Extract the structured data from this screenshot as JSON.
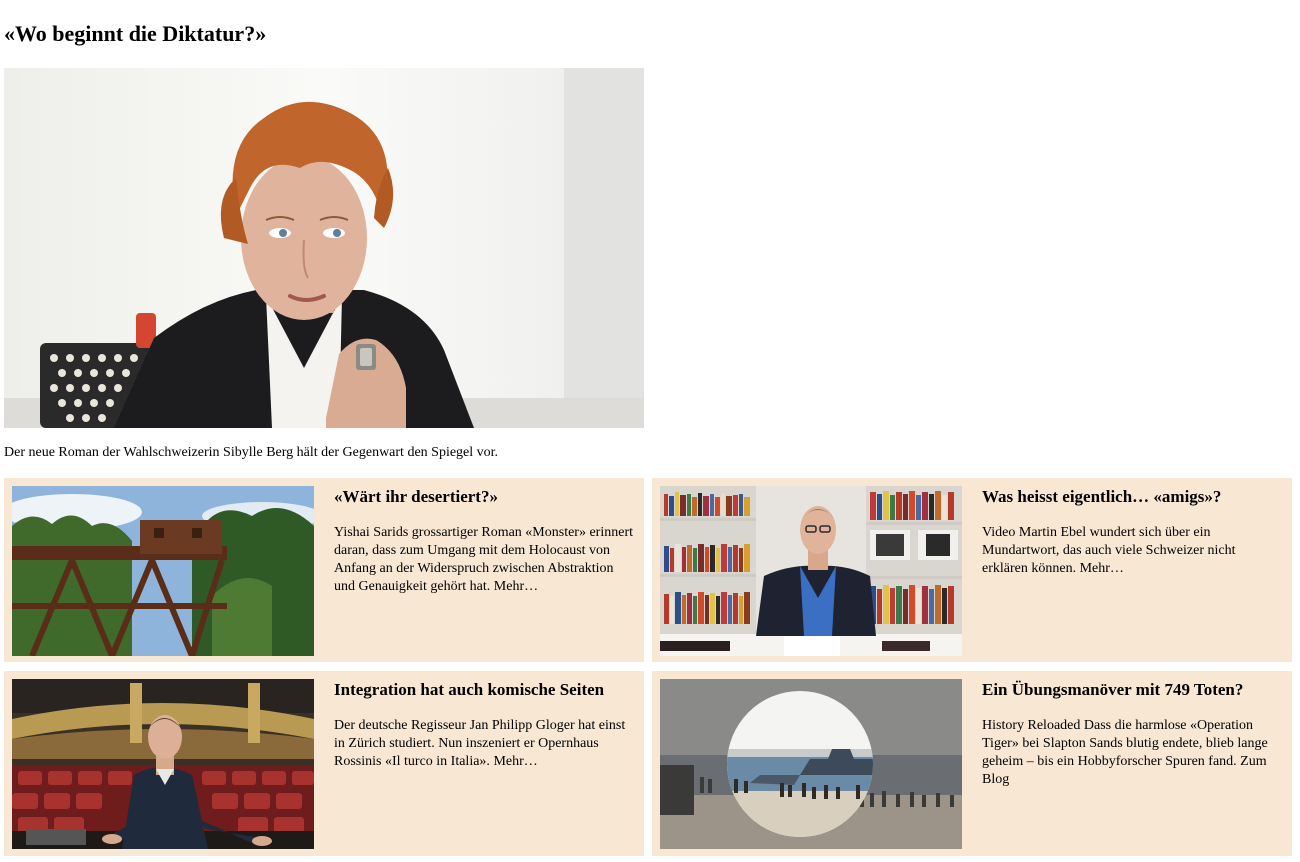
{
  "article": {
    "title": "«Wo beginnt die Diktatur?»",
    "caption": "Der neue Roman der Wahlschweizerin Sibylle Berg hält der Gegenwart den Spiegel vor."
  },
  "teasers": [
    {
      "headline": "«Wärt ihr desertiert?»",
      "text": "Yishai Sarids grossartiger Roman «Monster» erinnert daran, dass zum Umgang mit dem Holocaust von Anfang an der Widerspruch zwischen Abstraktion und Genauigkeit gehört hat.",
      "more": "Mehr…"
    },
    {
      "headline": "Was heisst eigentlich… «amigs»?",
      "text": "Video Martin Ebel wundert sich über ein Mundartwort, das auch viele Schweizer nicht erklären können.",
      "more": "Mehr…"
    },
    {
      "headline": "Integration hat auch komische Seiten",
      "text": "Der deutsche Regisseur Jan Philipp Gloger hat einst in Zürich studiert. Nun inszeniert er Opernhaus Rossinis «Il turco in Italia».",
      "more": "Mehr…"
    },
    {
      "headline": "Ein Übungsmanöver mit 749 Toten?",
      "text": "History Reloaded Dass die harmlose «Operation Tiger» bei Slapton Sands blutig endete, blieb lange geheim – bis ein Hobbyforscher Spuren fand.",
      "more": "Zum Blog"
    }
  ],
  "colors": {
    "teaser_background": "#f8e7d2",
    "hair": "#c0652b",
    "jacket": "#1c1c1e"
  }
}
